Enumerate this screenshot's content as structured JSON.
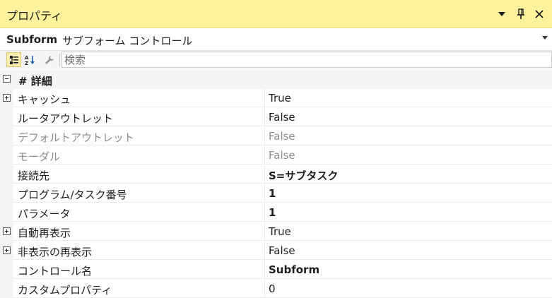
{
  "window": {
    "title": "プロパティ"
  },
  "object_selector": {
    "name": "Subform",
    "type": "サブフォーム コントロール"
  },
  "search": {
    "placeholder": "検索"
  },
  "category": {
    "label": "# 詳細"
  },
  "properties": [
    {
      "name": "キャッシュ",
      "value": "True",
      "expandable": true,
      "bold": false,
      "disabled": false
    },
    {
      "name": "ルータアウトレット",
      "value": "False",
      "expandable": false,
      "bold": false,
      "disabled": false
    },
    {
      "name": "デフォルトアウトレット",
      "value": "False",
      "expandable": false,
      "bold": false,
      "disabled": true
    },
    {
      "name": "モーダル",
      "value": "False",
      "expandable": false,
      "bold": false,
      "disabled": true
    },
    {
      "name": "接続先",
      "value": "S=サブタスク",
      "expandable": false,
      "bold": true,
      "disabled": false
    },
    {
      "name": "プログラム/タスク番号",
      "value": "1",
      "expandable": false,
      "bold": true,
      "disabled": false
    },
    {
      "name": "パラメータ",
      "value": "1",
      "expandable": false,
      "bold": true,
      "disabled": false
    },
    {
      "name": "自動再表示",
      "value": "True",
      "expandable": true,
      "bold": false,
      "disabled": false
    },
    {
      "name": "非表示の再表示",
      "value": "False",
      "expandable": true,
      "bold": false,
      "disabled": false
    },
    {
      "name": "コントロール名",
      "value": "Subform",
      "expandable": false,
      "bold": true,
      "disabled": false
    },
    {
      "name": "カスタムプロパティ",
      "value": "0",
      "expandable": false,
      "bold": false,
      "disabled": false
    }
  ],
  "colors": {
    "title_bar": "#fff29d",
    "disabled_text": "#8d8d8d",
    "gutter": "#f5f5f5"
  },
  "icons": [
    "dropdown-arrow-icon",
    "pin-icon",
    "close-icon",
    "categorized-icon",
    "alphabetical-icon",
    "property-pages-icon"
  ]
}
